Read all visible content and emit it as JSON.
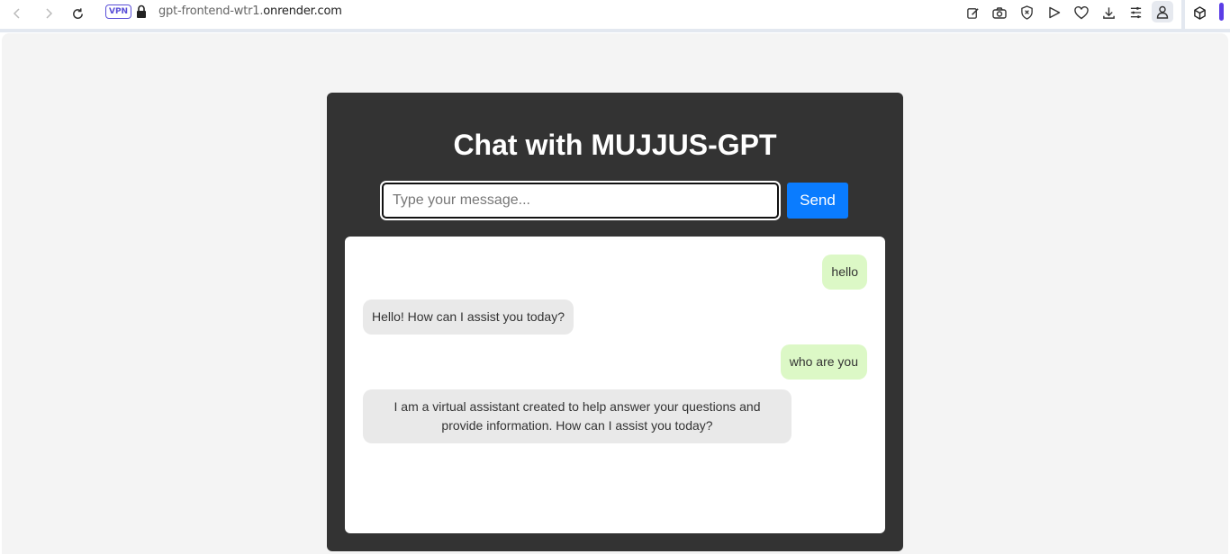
{
  "browser": {
    "vpn_label": "VPN",
    "url_prefix": "gpt-frontend-wtr1.",
    "url_host": "onrender.com"
  },
  "chat": {
    "title": "Chat with MUJJUS-GPT",
    "input_placeholder": "Type your message...",
    "input_value": "",
    "send_label": "Send",
    "messages": [
      {
        "role": "user",
        "text": "hello"
      },
      {
        "role": "bot",
        "text": "Hello! How can I assist you today?"
      },
      {
        "role": "user",
        "text": "who are you"
      },
      {
        "role": "bot",
        "text": "I am a virtual assistant created to help answer your questions and provide information. How can I assist you today?"
      }
    ]
  },
  "colors": {
    "page_bg": "#f4f4f4",
    "card_bg": "#333333",
    "send_button": "#0a7cff",
    "user_bubble": "#dcf8c6",
    "bot_bubble": "#e9e9e9",
    "vpn_accent": "#5a4fd8"
  },
  "icons": {
    "toolbar_left": [
      "back-arrow-icon",
      "forward-arrow-icon",
      "reload-icon",
      "lock-icon"
    ],
    "toolbar_right": [
      "edit-icon",
      "camera-icon",
      "shield-icon",
      "play-icon",
      "heart-icon",
      "download-icon",
      "menu-lines-icon",
      "profile-icon",
      "cube-icon"
    ]
  }
}
